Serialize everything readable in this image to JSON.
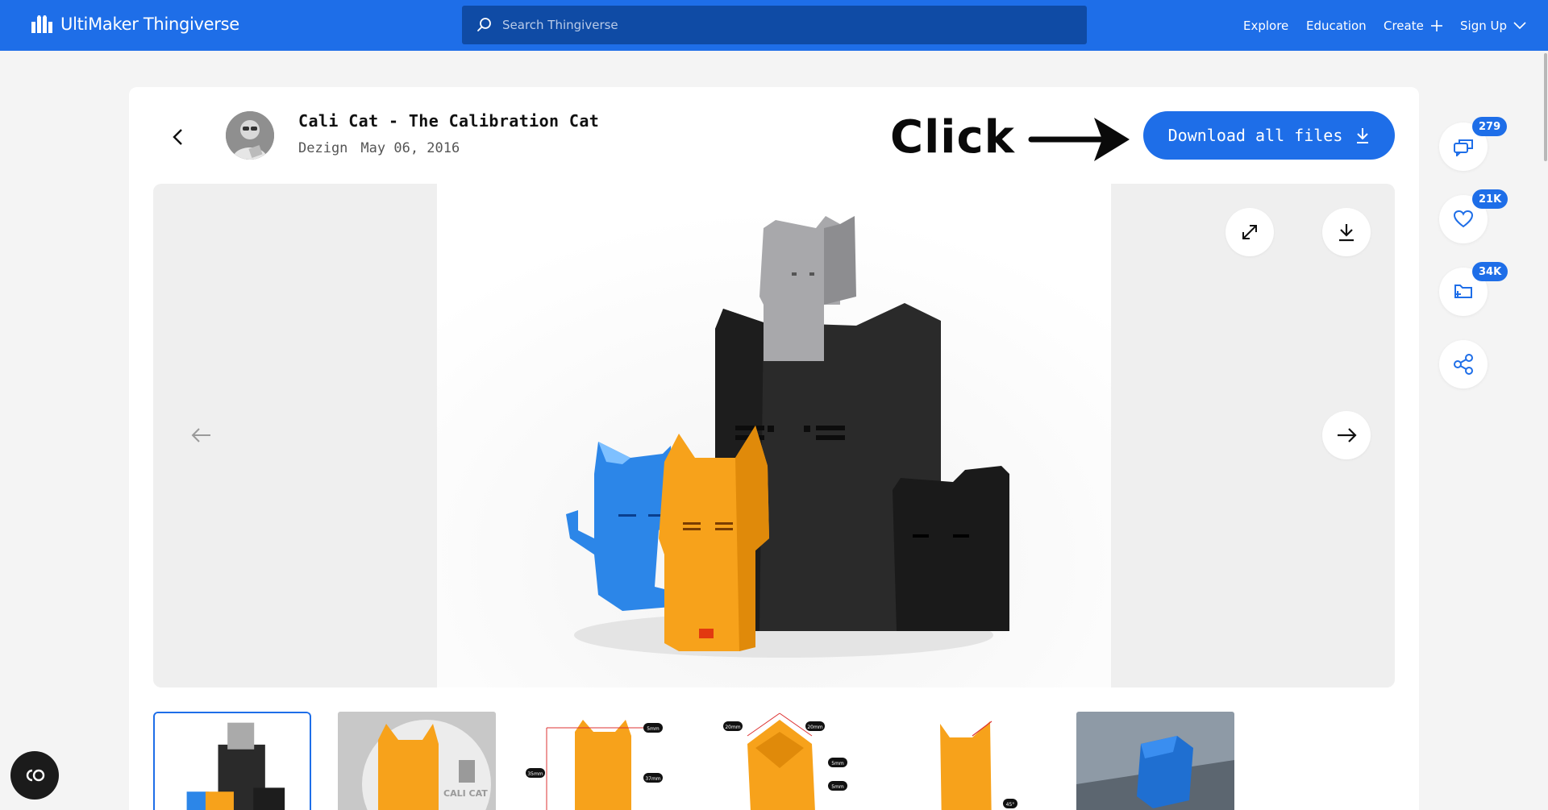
{
  "brand": {
    "name": "UltiMaker Thingiverse",
    "color": "#1e6ee8"
  },
  "search": {
    "placeholder": "Search Thingiverse",
    "icon": "search-icon"
  },
  "nav": {
    "explore": "Explore",
    "education": "Education",
    "create": "Create",
    "signup": "Sign Up"
  },
  "thing": {
    "title": "Cali Cat - The Calibration Cat",
    "author": "Dezign",
    "date": "May 06, 2016"
  },
  "annotation": {
    "text": "Click"
  },
  "actions": {
    "download_all": "Download all files"
  },
  "stats": {
    "comments": "279",
    "likes": "21K",
    "collections": "34K"
  },
  "thumbnails": [
    {
      "name": "thumb-1",
      "label": ""
    },
    {
      "name": "thumb-2",
      "label": "CALI CAT"
    },
    {
      "name": "thumb-3",
      "labels": [
        "5mm",
        "35mm",
        "37mm"
      ]
    },
    {
      "name": "thumb-4",
      "labels": [
        "20mm",
        "20mm",
        "5mm",
        "5mm"
      ]
    },
    {
      "name": "thumb-5",
      "labels": [
        "45°"
      ]
    },
    {
      "name": "thumb-6",
      "label": ""
    }
  ]
}
